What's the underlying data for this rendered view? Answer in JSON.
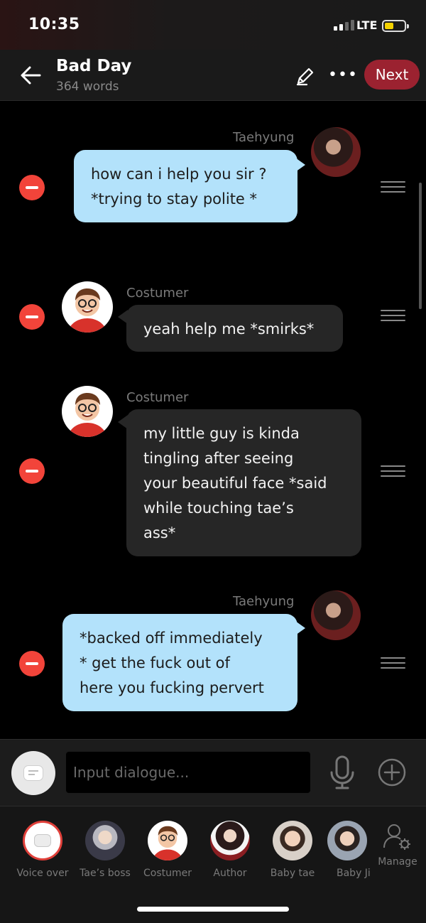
{
  "status_bar": {
    "time": "10:35",
    "network": "LTE"
  },
  "header": {
    "title": "Bad Day",
    "subtitle": "364 words",
    "next_label": "Next"
  },
  "messages": [
    {
      "speaker": "Taehyung",
      "side": "right",
      "lines": [
        "how can i help you sir ?",
        "*trying to stay polite *"
      ]
    },
    {
      "speaker": "Costumer",
      "side": "left",
      "lines": [
        "yeah help me *smirks*"
      ]
    },
    {
      "speaker": "Costumer",
      "side": "left",
      "lines": [
        "my little guy is kinda",
        "tingling after seeing",
        "your beautiful face *said",
        "while touching tae’s",
        "ass*"
      ]
    },
    {
      "speaker": "Taehyung",
      "side": "right",
      "lines": [
        "*backed off immediately",
        "* get the fuck out of",
        "here you fucking pervert"
      ]
    }
  ],
  "input": {
    "placeholder": "Input dialogue..."
  },
  "roles": [
    {
      "label": "Voice over",
      "icon": "chat-bubble-icon"
    },
    {
      "label": "Tae’s boss",
      "icon": "avatar"
    },
    {
      "label": "Costumer",
      "icon": "avatar"
    },
    {
      "label": "Author",
      "icon": "avatar"
    },
    {
      "label": "Baby tae",
      "icon": "avatar"
    },
    {
      "label": "Baby Ji",
      "icon": "avatar"
    },
    {
      "label": "Manage",
      "icon": "manage-user-icon"
    }
  ],
  "colors": {
    "accent": "#9b2230",
    "bubble_self": "#b3e2fb",
    "bubble_other": "#262626",
    "delete": "#f2443a"
  }
}
